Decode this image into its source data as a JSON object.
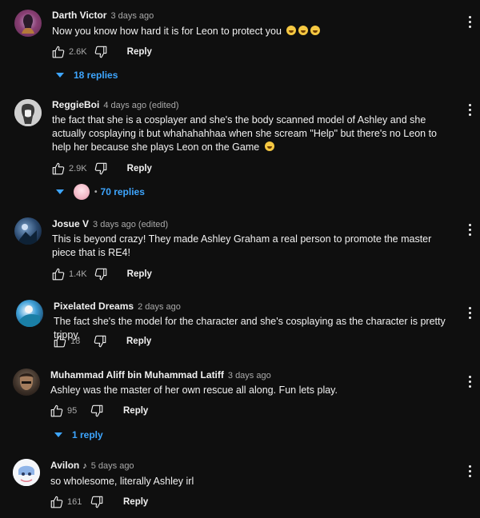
{
  "comments": [
    {
      "author": "Darth Victor",
      "time": "3 days ago",
      "text": "Now you know how hard it is for Leon to protect you",
      "likes": "2.6K",
      "reply": "Reply",
      "replies": "18 replies"
    },
    {
      "author": "ReggieBoi",
      "time": "4 days ago (edited)",
      "text": "the fact that she is a cosplayer and she's the body scanned model of Ashley and she actually cosplaying it but whahahahhaa when she scream \"Help\" but there's no Leon to help her because she plays Leon on the Game",
      "likes": "2.9K",
      "reply": "Reply",
      "replies": "70 replies",
      "replies_sep": "•"
    },
    {
      "author": "Josue V",
      "time": "3 days ago (edited)",
      "text": "This is beyond crazy! They made Ashley Graham a real person to promote the master piece that is RE4!",
      "likes": "1.4K",
      "reply": "Reply"
    },
    {
      "author": "Pixelated Dreams",
      "time": "2 days ago",
      "text": "The fact she's the model for the character and she's cosplaying as the character is pretty trippy.",
      "likes": "18",
      "reply": "Reply"
    },
    {
      "author": "Muhammad Aliff bin Muhammad Latiff",
      "time": "3 days ago",
      "text": "Ashley was the master of her own rescue all along. Fun lets play.",
      "likes": "95",
      "reply": "Reply",
      "replies": "1 reply"
    },
    {
      "author": "Avilon",
      "note": "♪",
      "time": "5 days ago",
      "text": "so wholesome, literally Ashley irl",
      "likes": "161",
      "reply": "Reply"
    }
  ],
  "icons": {
    "like": "thumbs-up-icon",
    "dislike": "thumbs-down-icon",
    "more": "more-vert-icon",
    "expand": "caret-down-icon"
  },
  "colors": {
    "background": "#0f0f0f",
    "link": "#3ea6ff",
    "secondary": "#aaaaaa"
  }
}
